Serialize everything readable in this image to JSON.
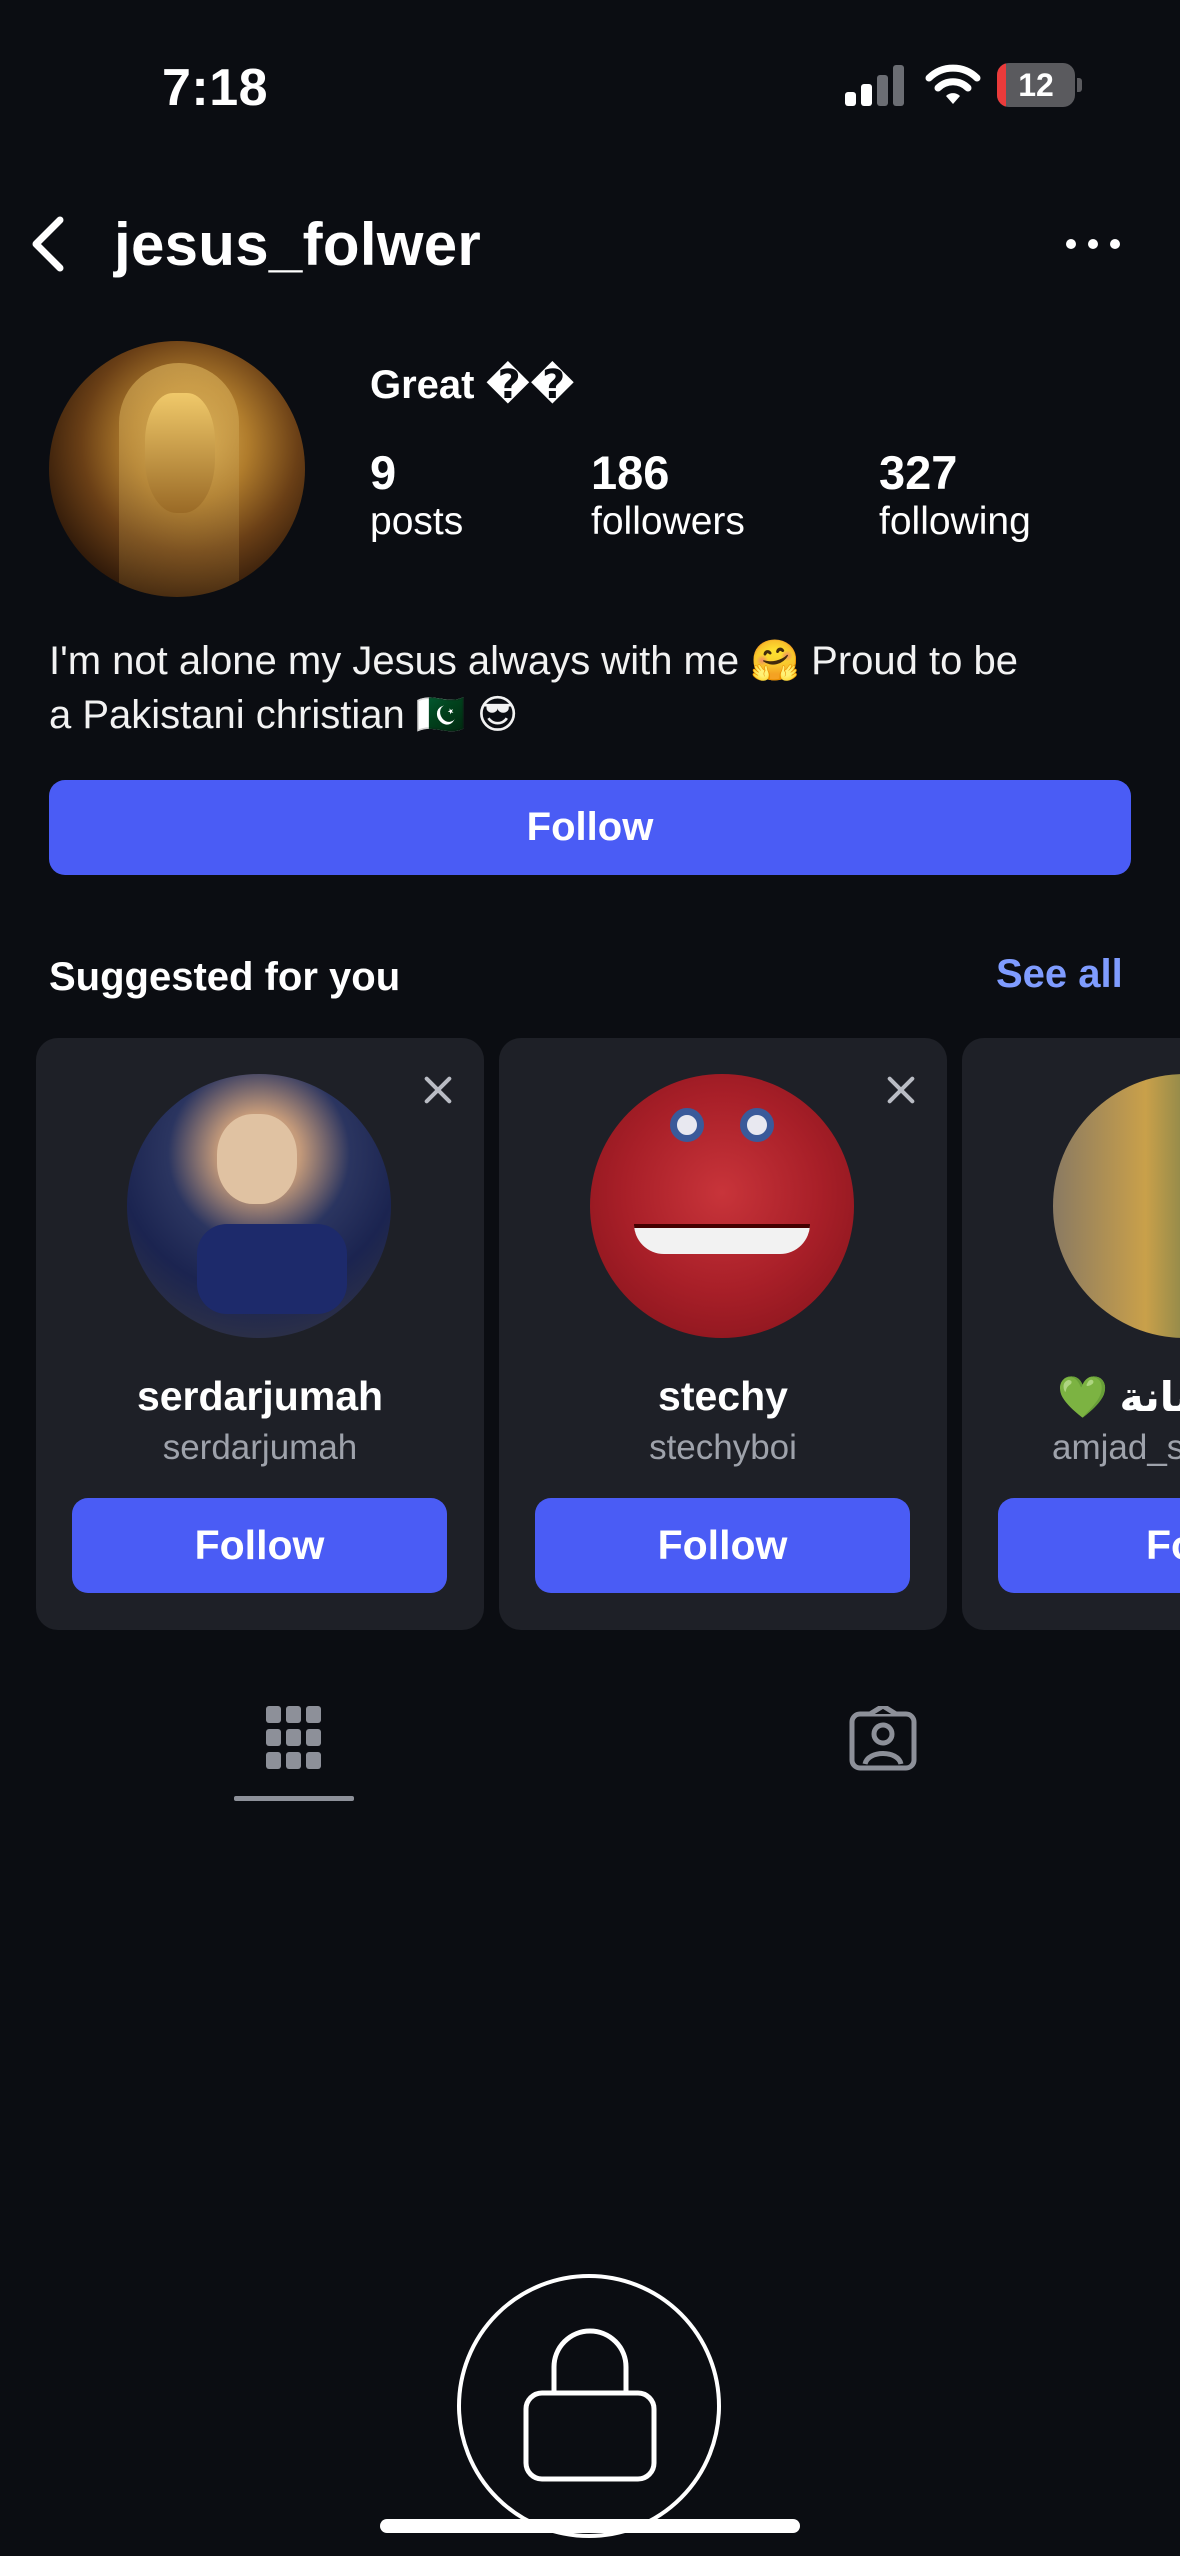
{
  "status_bar": {
    "time": "7:18",
    "battery": "12"
  },
  "header": {
    "username": "jesus_folwer"
  },
  "profile": {
    "display_name": "Great ��",
    "stats": [
      {
        "value": "9",
        "label": "posts"
      },
      {
        "value": "186",
        "label": "followers"
      },
      {
        "value": "327",
        "label": "following"
      }
    ],
    "bio_line1": "I'm not alone my Jesus always with me 🤗 Proud to be",
    "bio_line2": "a Pakistani christian 🇵🇰 😎",
    "follow_label": "Follow"
  },
  "suggested": {
    "title": "Suggested for you",
    "see_all": "See all",
    "cards": [
      {
        "name": "serdarjumah",
        "handle": "serdarjumah",
        "button": "Follow"
      },
      {
        "name": "stechy",
        "handle": "stechyboi",
        "button": "Follow"
      },
      {
        "name": "💚 بانة",
        "handle": "amjad_s",
        "button": "Follow"
      }
    ]
  },
  "colors": {
    "accent": "#4a5cf5",
    "link": "#7f9cff",
    "background": "#0b0d12",
    "card": "#1e2027"
  }
}
